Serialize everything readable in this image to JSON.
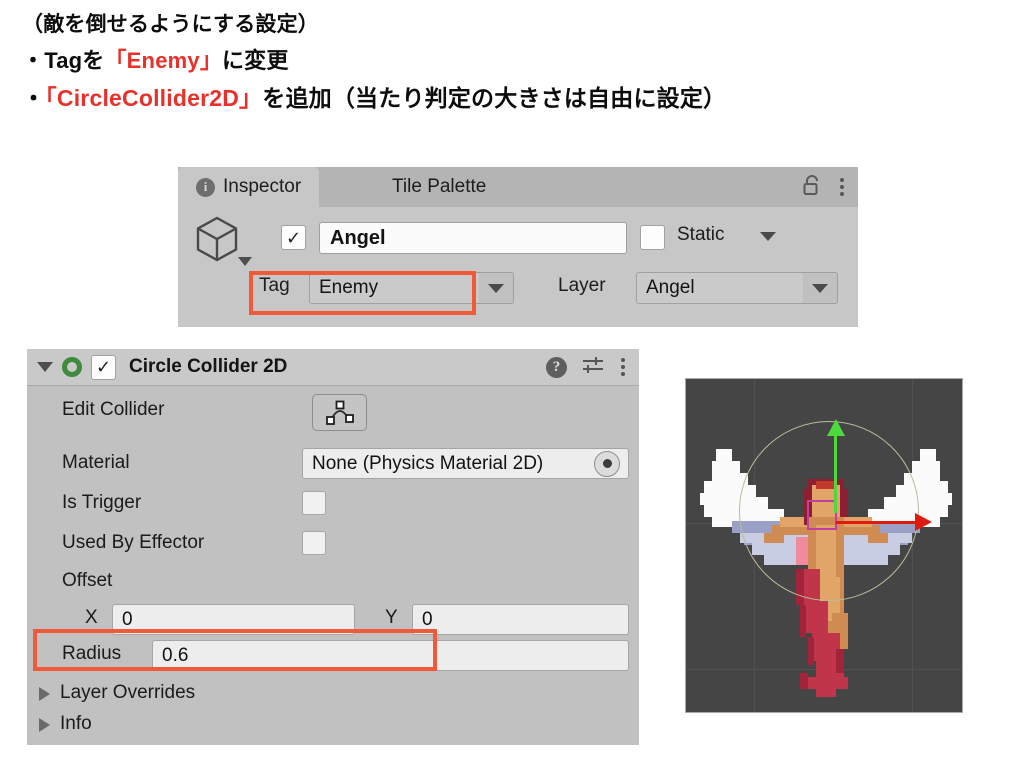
{
  "instructions": {
    "line1": "（敵を倒せるようにする設定）",
    "line2_bullet": "・",
    "line2_a": "Tagを",
    "line2_red": "「Enemy」",
    "line2_b": "に変更",
    "line3_bullet": "・",
    "line3_red": "「CircleCollider2D」",
    "line3_b": "を追加（当たり判定の大きさは自由に設定）",
    "highlight_color": "#e8312a"
  },
  "inspector": {
    "tabs": [
      {
        "label": "Inspector",
        "icon": "info-icon",
        "active": true
      },
      {
        "label": "Tile Palette",
        "icon": "",
        "active": false
      }
    ],
    "lock_icon": "lock-open-icon",
    "menu_icon": "kebab-menu-icon",
    "object": {
      "icon": "cube-icon",
      "enabled_checkbox": "✓",
      "name": "Angel",
      "static_checkbox": "",
      "static_label": "Static"
    },
    "tag": {
      "label": "Tag",
      "value": "Enemy"
    },
    "layer": {
      "label": "Layer",
      "value": "Angel"
    }
  },
  "collider": {
    "title": "Circle Collider 2D",
    "enabled_checkbox": "✓",
    "icon": "circle-collider-icon",
    "help_icon": "help-icon",
    "preset_icon": "preset-sliders-icon",
    "menu_icon": "kebab-menu-icon",
    "rows": {
      "edit_collider_label": "Edit Collider",
      "material_label": "Material",
      "material_value": "None (Physics Material 2D)",
      "is_trigger_label": "Is Trigger",
      "used_by_effector_label": "Used By Effector",
      "offset_label": "Offset",
      "offset_x_label": "X",
      "offset_x_value": "0",
      "offset_y_label": "Y",
      "offset_y_value": "0",
      "radius_label": "Radius",
      "radius_value": "0.6",
      "layer_overrides_label": "Layer Overrides",
      "info_label": "Info"
    }
  },
  "preview": {
    "name": "angel-sprite-preview",
    "gizmo_circle": "collider-circle-gizmo",
    "up_axis_color": "#4fd83d",
    "right_axis_color": "#e01b0e",
    "background_color": "#454545"
  },
  "highlights": {
    "color": "#f05a38",
    "tag_box": "tag-field-highlight",
    "radius_box": "radius-field-highlight"
  }
}
